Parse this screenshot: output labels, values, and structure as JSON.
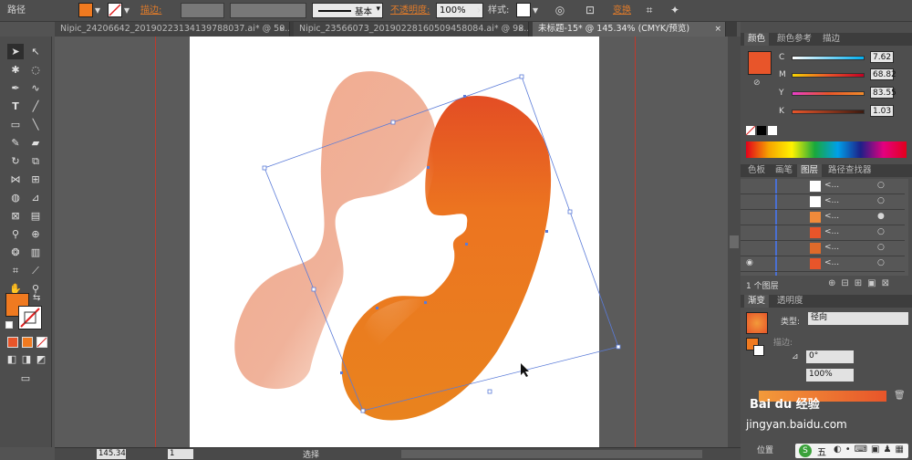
{
  "control_bar": {
    "selection_label": "路径",
    "stroke_label": "描边:",
    "stroke_profile": "基本",
    "opacity_label": "不透明度:",
    "opacity_value": "100%",
    "style_label": "样式:",
    "transform_label": "变换",
    "fill_color": "#f07a20"
  },
  "tabs": [
    {
      "label": "Nipic_24206642_20190223134139788037.ai* @ 50...",
      "close": "×"
    },
    {
      "label": "Nipic_23566073_20190228160509458084.ai* @ 98...",
      "close": "×"
    },
    {
      "label": "未标题-15* @ 145.34% (CMYK/预览)",
      "close": "×"
    }
  ],
  "color_panel": {
    "tabs": [
      "颜色",
      "颜色参考",
      "描边"
    ],
    "channels": [
      {
        "name": "C",
        "value": "7.62"
      },
      {
        "name": "M",
        "value": "68.82"
      },
      {
        "name": "Y",
        "value": "83.55"
      },
      {
        "name": "K",
        "value": "1.03"
      }
    ],
    "swatch": "#e8552a"
  },
  "layers_panel": {
    "tabs": [
      "色板",
      "画笔",
      "图层",
      "路径查找器"
    ],
    "rows": [
      {
        "name": "<...",
        "thumb": "#ffffff"
      },
      {
        "name": "<...",
        "thumb": "#ffffff"
      },
      {
        "name": "<...",
        "thumb": "#f08a3a"
      },
      {
        "name": "<...",
        "thumb": "#e8552a"
      },
      {
        "name": "<...",
        "thumb": "#e06a2a"
      },
      {
        "name": "<...",
        "thumb": "#e8552a"
      }
    ],
    "footer": "1 个图层"
  },
  "gradient_panel": {
    "tabs": [
      "渐变",
      "透明度"
    ],
    "type_label": "类型:",
    "type_value": "径向",
    "stroke_label": "描边:",
    "angle_value": "0°",
    "opacity_value": "100%",
    "position_label": "位置"
  },
  "status_bar": {
    "zoom": "145.34",
    "page": "1",
    "tool_name": "选择",
    "watermark_top": "Bai du 经验",
    "watermark_bottom": "jingyan.baidu.com"
  },
  "taskbar": {
    "ime_label": "五"
  }
}
